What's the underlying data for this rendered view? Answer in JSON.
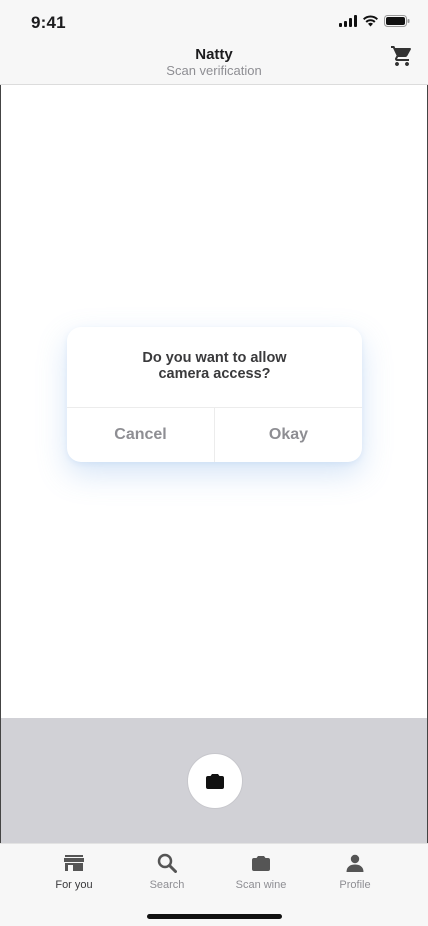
{
  "status_bar": {
    "time": "9:41"
  },
  "header": {
    "title": "Natty",
    "subtitle": "Scan verification",
    "cart_icon": "cart-icon"
  },
  "dialog": {
    "message": "Do you want to allow camera access?",
    "cancel_label": "Cancel",
    "okay_label": "Okay"
  },
  "camera": {
    "shutter_icon": "camera-icon"
  },
  "tabs": [
    {
      "label": "For you",
      "icon": "store-icon",
      "active": true
    },
    {
      "label": "Search",
      "icon": "search-icon",
      "active": false
    },
    {
      "label": "Scan wine",
      "icon": "scan-icon",
      "active": false
    },
    {
      "label": "Profile",
      "icon": "person-icon",
      "active": false
    }
  ],
  "colors": {
    "background": "#f7f7f7",
    "camera_panel": "#d1d1d6",
    "muted_text": "#8e8e93",
    "dialog_shadow": "#78aae6"
  }
}
